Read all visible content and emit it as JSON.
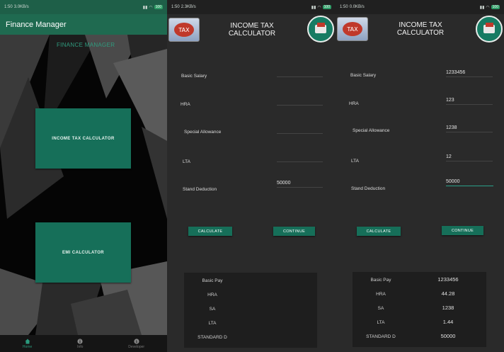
{
  "status": {
    "p1": {
      "time": "1:50",
      "speed": "3.0KB/s",
      "battery": "100"
    },
    "p2": {
      "time": "1:50",
      "speed": "2.3KB/s",
      "battery": "100"
    },
    "p3": {
      "time": "1:50",
      "speed": "0.0KB/s",
      "battery": "100"
    }
  },
  "home": {
    "app_title": "Finance Manager",
    "heading": "FINANCE MANAGER",
    "income_tax_button": "INCOME TAX CALCULATOR",
    "emi_button": "EMI CALCULATOR",
    "nav": [
      {
        "label": "Home",
        "icon": "home-icon",
        "active": true
      },
      {
        "label": "Info",
        "icon": "info-icon",
        "active": false
      },
      {
        "label": "Developer",
        "icon": "developer-icon",
        "active": false
      }
    ]
  },
  "calc": {
    "title_line1": "INCOME TAX",
    "title_line2": "CALCULATOR",
    "logo_text": "TAX",
    "labels": {
      "basic": "Basic Salary",
      "hra": "HRA",
      "special": "Special Allowance",
      "lta": "LTA",
      "std": "Stand Deduction"
    },
    "buttons": {
      "calculate": "CALCULATE",
      "continue": "CONTINUE"
    },
    "result_labels": {
      "basic": "Basic Pay",
      "hra": "HRA",
      "sa": "SA",
      "lta": "LTA",
      "std": "STANDARD D"
    }
  },
  "screen2": {
    "inputs": {
      "basic": "",
      "hra": "",
      "special": "",
      "lta": "",
      "std": "50000"
    },
    "results": {
      "basic": "",
      "hra": "",
      "sa": "",
      "lta": "",
      "std": ""
    }
  },
  "screen3": {
    "inputs": {
      "basic": "1233456",
      "hra": "123",
      "special": "1238",
      "lta": "12",
      "std": "50000"
    },
    "results": {
      "basic": "1233456",
      "hra": "44.28",
      "sa": "1238",
      "lta": "1.44",
      "std": "50000"
    }
  },
  "colors": {
    "accent": "#166f59",
    "appbar": "#1f6a50",
    "panel": "#2a2a2a",
    "result_panel": "#1e1e1e"
  }
}
